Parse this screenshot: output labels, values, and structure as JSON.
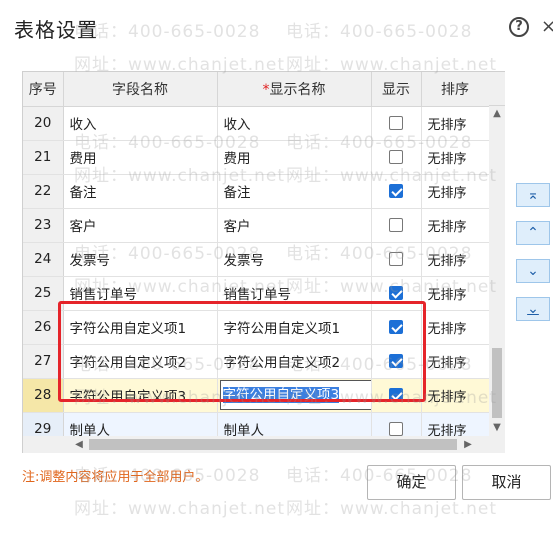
{
  "dialog": {
    "title": "表格设置"
  },
  "watermark": {
    "phone": "电话：400-665-0028",
    "site": "网址：www.chanjet.net"
  },
  "grid": {
    "headers": {
      "index": "序号",
      "field_name": "字段名称",
      "required_mark": "*",
      "display_name": "显示名称",
      "show": "显示",
      "sort": "排序"
    },
    "rows": [
      {
        "index": "20",
        "field_name": "收入",
        "display_name": "收入",
        "show": false,
        "sort": "无排序"
      },
      {
        "index": "21",
        "field_name": "费用",
        "display_name": "费用",
        "show": false,
        "sort": "无排序"
      },
      {
        "index": "22",
        "field_name": "备注",
        "display_name": "备注",
        "show": true,
        "sort": "无排序"
      },
      {
        "index": "23",
        "field_name": "客户",
        "display_name": "客户",
        "show": false,
        "sort": "无排序"
      },
      {
        "index": "24",
        "field_name": "发票号",
        "display_name": "发票号",
        "show": false,
        "sort": "无排序"
      },
      {
        "index": "25",
        "field_name": "销售订单号",
        "display_name": "销售订单号",
        "show": true,
        "sort": "无排序"
      },
      {
        "index": "26",
        "field_name": "字符公用自定义项1",
        "display_name": "字符公用自定义项1",
        "show": true,
        "sort": "无排序"
      },
      {
        "index": "27",
        "field_name": "字符公用自定义项2",
        "display_name": "字符公用自定义项2",
        "show": true,
        "sort": "无排序"
      },
      {
        "index": "28",
        "field_name": "字符公用自定义项3",
        "display_name": "字符公用自定义项3",
        "show": true,
        "sort": "无排序",
        "editing": true
      },
      {
        "index": "29",
        "field_name": "制单人",
        "display_name": "制单人",
        "show": false,
        "sort": "无排序"
      }
    ]
  },
  "side_buttons": {
    "top": "⌅",
    "up": "⌃",
    "down": "⌄",
    "bottom": "⌄"
  },
  "footer": {
    "note": "注:调整内容将应用于全部用户。",
    "ok_label": "确定",
    "cancel_label": "取消"
  },
  "colors": {
    "highlight": "#e5242a",
    "checkbox_on": "#1c6fd6",
    "note": "#e0661c"
  }
}
